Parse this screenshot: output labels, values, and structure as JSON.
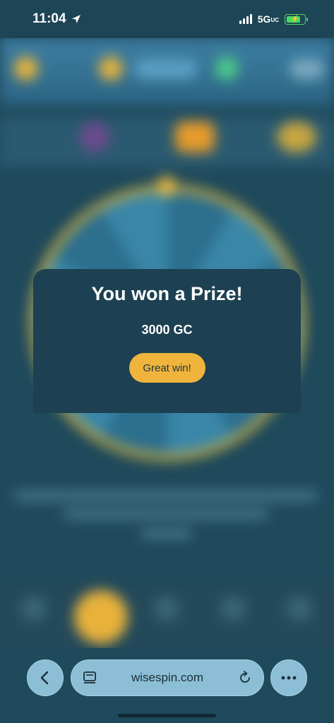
{
  "status_bar": {
    "time": "11:04",
    "network": "5G",
    "network_suffix": "UC",
    "battery_color": "#4cd964"
  },
  "modal": {
    "title": "You won a Prize!",
    "amount": "3000 GC",
    "button_label": "Great win!",
    "button_color": "#f0b43c",
    "background_color": "#1d4152"
  },
  "browser": {
    "url": "wisespin.com",
    "back_icon": "chevron-left-icon",
    "tabs_icon": "tabs-icon",
    "reload_icon": "reload-icon",
    "more_icon": "more-icon"
  },
  "colors": {
    "page_background": "#1f4a5c",
    "wheel_rim": "#d8b13b",
    "accent_gold": "#f0b43c"
  }
}
